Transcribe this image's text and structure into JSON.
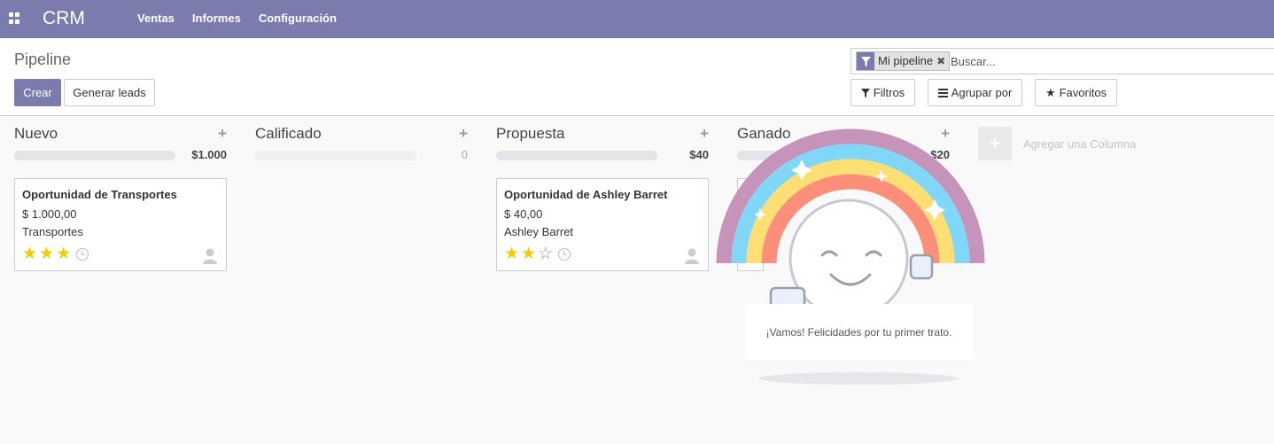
{
  "navbar": {
    "brand": "CRM",
    "menu": [
      "Ventas",
      "Informes",
      "Configuración"
    ]
  },
  "control": {
    "breadcrumb": "Pipeline",
    "create_label": "Crear",
    "generate_label": "Generar leads",
    "search": {
      "facet": "Mi pipeline",
      "placeholder": "Buscar..."
    },
    "filters_label": "Filtros",
    "group_label": "Agrupar por",
    "favorites_label": "Favoritos"
  },
  "columns": [
    {
      "title": "Nuevo",
      "total": "$1.000",
      "cards": [
        {
          "title": "Oportunidad de Transportes",
          "amount": "$ 1.000,00",
          "company": "Transportes",
          "stars": 3
        }
      ]
    },
    {
      "title": "Calificado",
      "total": "0",
      "cards": []
    },
    {
      "title": "Propuesta",
      "total": "$40",
      "cards": [
        {
          "title": "Oportunidad de Ashley Barret",
          "amount": "$ 40,00",
          "company": "Ashley Barret",
          "stars": 2
        }
      ]
    },
    {
      "title": "Ganado",
      "total": "$20",
      "cards": []
    }
  ],
  "add_column_label": "Agregar una Columna",
  "rainbow": {
    "message": "¡Vamos! Felicidades por tu primer trato."
  },
  "colors": {
    "brand": "#7c7bad",
    "star": "#f3cc00"
  }
}
